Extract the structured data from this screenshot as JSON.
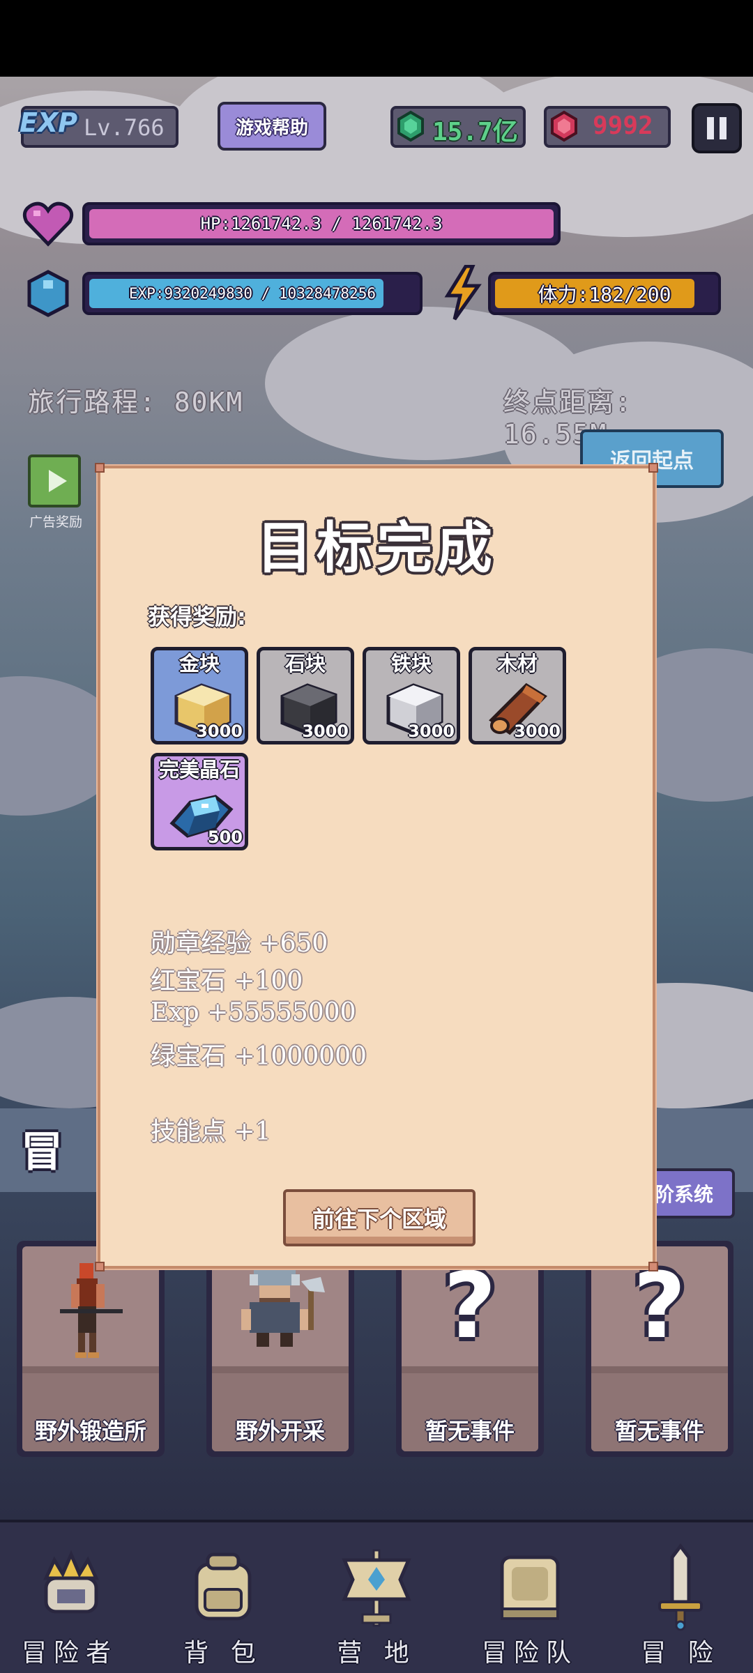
{
  "hud": {
    "level_label": "Lv.766",
    "exp_badge": "EXP",
    "help_button": "游戏帮助",
    "emerald_amount": "15.7亿",
    "ruby_amount": "9992",
    "pause_icon": "pause-icon"
  },
  "bars": {
    "hp_text": "HP:1261742.3 / 1261742.3",
    "hp_fraction": 1.0,
    "exp_text": "EXP:9320249830 / 10328478256",
    "exp_fraction": 0.902,
    "stamina_text": "体力:182/200",
    "stamina_fraction": 0.91
  },
  "travel": {
    "distance_traveled": "旅行路程: 80KM",
    "distance_to_end": "终点距离: 16.55M",
    "return_button": "返回起点",
    "ad_reward_label": "广告奖励"
  },
  "section": {
    "adventure_title_partial": "冒 险",
    "advance_system_button": "进阶系统"
  },
  "event_cards": [
    {
      "label": "野外锻造所"
    },
    {
      "label": "野外开采"
    },
    {
      "label": "暂无事件"
    },
    {
      "label": "暂无事件"
    }
  ],
  "bottom_nav": [
    {
      "label": "冒险者"
    },
    {
      "label": "背 包"
    },
    {
      "label": "营 地"
    },
    {
      "label": "冒险队"
    },
    {
      "label": "冒 险"
    }
  ],
  "modal": {
    "title": "目标完成",
    "rewards_heading": "获得奖励:",
    "items": [
      {
        "name": "金块",
        "qty": "3000",
        "icon": "gold-block-icon",
        "bg": "#7d9ad8"
      },
      {
        "name": "石块",
        "qty": "3000",
        "icon": "stone-block-icon",
        "bg": "#b9b5b8"
      },
      {
        "name": "铁块",
        "qty": "3000",
        "icon": "iron-block-icon",
        "bg": "#b9b5b8"
      },
      {
        "name": "木材",
        "qty": "3000",
        "icon": "wood-log-icon",
        "bg": "#b9b5b8"
      },
      {
        "name": "完美晶石",
        "qty": "500",
        "icon": "crystal-icon",
        "bg": "#c89ae6"
      }
    ],
    "stats": [
      "勋章经验 +650",
      "红宝石 +100",
      "Exp +55555000",
      "绿宝石 +1000000",
      "技能点 +1"
    ],
    "next_button": "前往下个区域"
  },
  "colors": {
    "hp_fill": "#d46cb8",
    "exp_fill": "#4fb0dc",
    "stamina_fill": "#e09a1a",
    "modal_bg": "#f6dcbf"
  }
}
